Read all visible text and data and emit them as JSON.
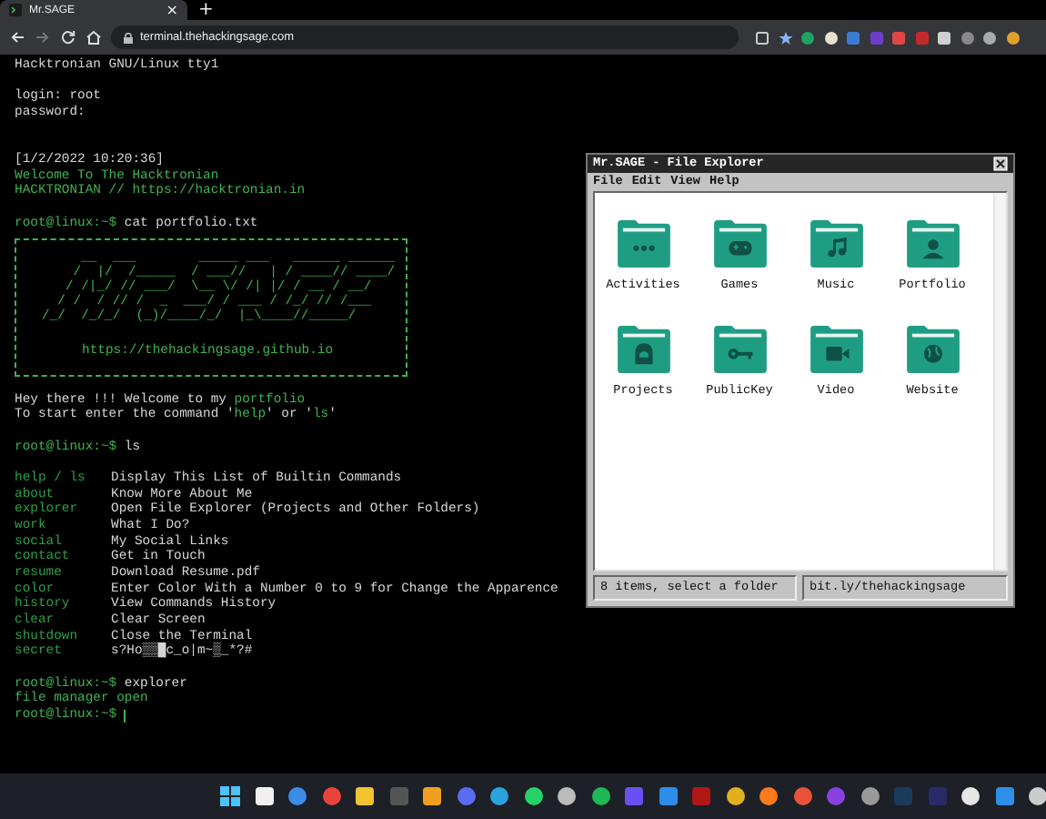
{
  "browser": {
    "tab": {
      "title": "Mr.SAGE",
      "close": "×"
    },
    "new_tab": "+",
    "address": "terminal.thehackingsage.com"
  },
  "terminal": {
    "blocks": [
      {
        "kind": "text",
        "cursor": false,
        "lines": [
          [
            {
              "text": "Hacktronian GNU/Linux tty1",
              "accent": false
            }
          ]
        ]
      },
      {
        "kind": "login",
        "cursor": false,
        "lines": [
          [
            {
              "text": "login: root",
              "accent": false
            }
          ],
          [
            {
              "text": "password:",
              "accent": false
            }
          ]
        ]
      },
      {
        "kind": "text",
        "cursor": false,
        "lines": [
          [
            {
              "text": "[1/2/2022 10:20:36]",
              "accent": false
            }
          ],
          [
            {
              "text": "Welcome To The Hacktronian",
              "accent": true
            }
          ],
          [
            {
              "text": "HACKTRONIAN // https://hacktronian.in",
              "accent": true
            }
          ]
        ]
      },
      {
        "kind": "text",
        "cursor": false,
        "lines": [
          [
            {
              "text": "root@linux:~$",
              "accent": true
            },
            {
              "text": " cat portfolio.txt",
              "accent": false
            }
          ]
        ]
      },
      {
        "kind": "banner",
        "art": [
          "     __  ___        _____ ___   ______ ______",
          "    /  |/  /_____  / ___//   | / ____// ____/",
          "   / /|_/ // ___/  \\__ \\/ /| |/ / __ / __/",
          "  / /  / // /  _  ___/ / ___ / /_/ // /___",
          "/_/  /_/_/  (_)/____/_/  |_\\____//_____/"
        ],
        "link": "https://thehackingsage.github.io"
      },
      {
        "kind": "text",
        "cursor": false,
        "lines": [
          [
            {
              "text": "Hey there !!! Welcome to my ",
              "accent": false
            },
            {
              "text": "portfolio",
              "accent": true
            }
          ],
          [
            {
              "text": "To start enter the command '",
              "accent": false
            },
            {
              "text": "help",
              "accent": true
            },
            {
              "text": "' or '",
              "accent": false
            },
            {
              "text": "ls",
              "accent": true
            },
            {
              "text": "'",
              "accent": false
            }
          ]
        ]
      },
      {
        "kind": "text",
        "cursor": false,
        "lines": [
          [
            {
              "text": "root@linux:~$",
              "accent": true
            },
            {
              "text": " ls",
              "accent": false
            }
          ]
        ]
      },
      {
        "kind": "commands",
        "rows": [
          {
            "command": "help / ls",
            "description": "Display This List of Builtin Commands"
          },
          {
            "command": "about",
            "description": "Know More About Me"
          },
          {
            "command": "explorer",
            "description": "Open File Explorer (Projects and Other Folders)"
          },
          {
            "command": "work",
            "description": "What I Do?"
          },
          {
            "command": "social",
            "description": "My Social Links"
          },
          {
            "command": "contact",
            "description": "Get in Touch"
          },
          {
            "command": "resume",
            "description": "Download Resume.pdf"
          },
          {
            "command": "color",
            "description": "Enter Color With a Number 0 to 9 for Change the Apparence"
          },
          {
            "command": "history",
            "description": "View Commands History"
          },
          {
            "command": "clear",
            "description": "Clear Screen"
          },
          {
            "command": "shutdown",
            "description": "Close the Terminal"
          },
          {
            "command": "secret",
            "description": "s?Ho▒▒█c_o|m~▒_*?#"
          }
        ]
      },
      {
        "kind": "text",
        "cursor": true,
        "lines": [
          [
            {
              "text": "root@linux:~$",
              "accent": true
            },
            {
              "text": " explorer",
              "accent": false
            }
          ],
          [
            {
              "text": "file manager open",
              "accent": true
            }
          ],
          [
            {
              "text": "root@linux:~$",
              "accent": true
            }
          ]
        ]
      }
    ]
  },
  "explorer": {
    "title": "Mr.SAGE - File Explorer",
    "menu": [
      "File",
      "Edit",
      "View",
      "Help"
    ],
    "folders": [
      {
        "name": "Activities"
      },
      {
        "name": "Games"
      },
      {
        "name": "Music"
      },
      {
        "name": "Portfolio"
      },
      {
        "name": "Projects"
      },
      {
        "name": "PublicKey"
      },
      {
        "name": "Video"
      },
      {
        "name": "Website"
      }
    ],
    "status": "8 items, select a folder",
    "link": "bit.ly/thehackingsage"
  }
}
